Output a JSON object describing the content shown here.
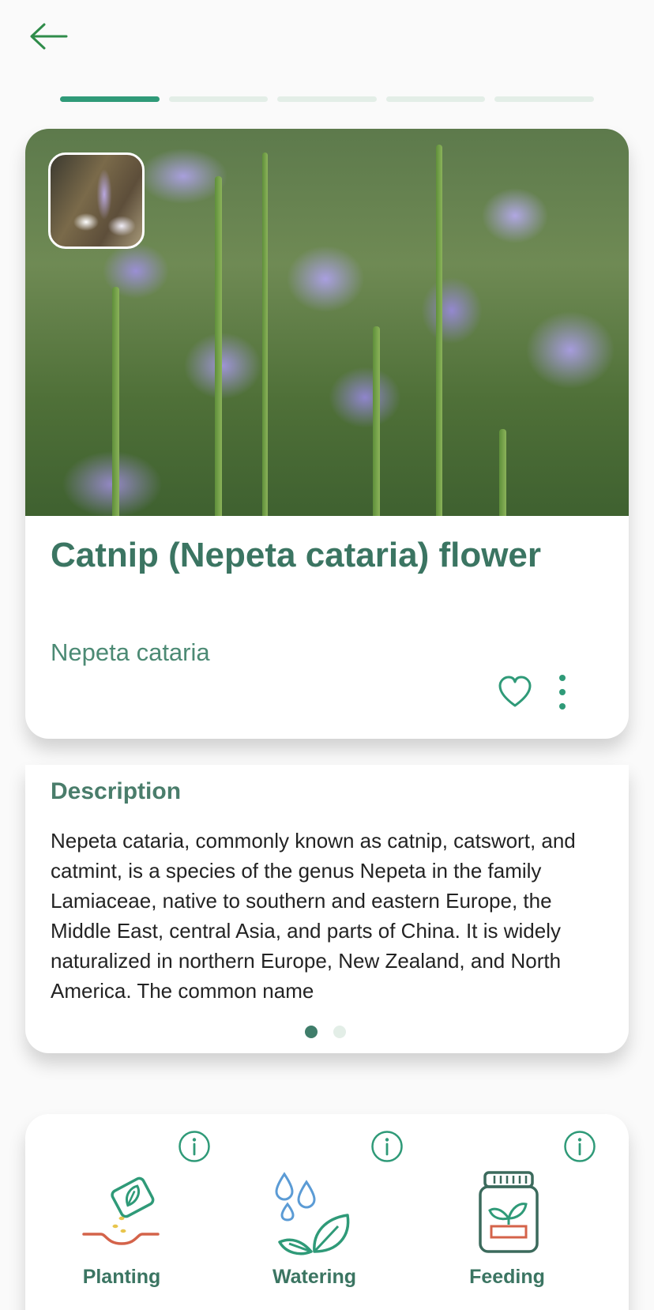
{
  "nav": {
    "back_icon": "arrow-left-icon"
  },
  "progress": {
    "total_steps": 5,
    "current_step": 1
  },
  "plant": {
    "title": "Catnip (Nepeta cataria) flower",
    "scientific_name": "Nepeta cataria",
    "favorite_icon": "heart-outline-icon",
    "more_icon": "more-vertical-icon"
  },
  "description": {
    "heading": "Description",
    "text": "Nepeta cataria, commonly known as catnip, catswort, and catmint, is a species of the genus Nepeta in the family Lamiaceae, native to southern and eastern Europe, the Middle East, central Asia, and parts of China. It is widely naturalized in northern Europe, New Zealand, and North America. The common name",
    "pages": 2,
    "current_page": 1
  },
  "care": {
    "items": [
      {
        "label": "Planting",
        "icon": "planting-icon",
        "info_icon": "info-icon"
      },
      {
        "label": "Watering",
        "icon": "watering-icon",
        "info_icon": "info-icon"
      },
      {
        "label": "Feeding",
        "icon": "feeding-icon",
        "info_icon": "info-icon"
      }
    ]
  },
  "colors": {
    "accent": "#2f9a78",
    "title_green": "#3b7562",
    "inactive_segment": "#e3eee7",
    "care_brown": "#d4634a"
  }
}
